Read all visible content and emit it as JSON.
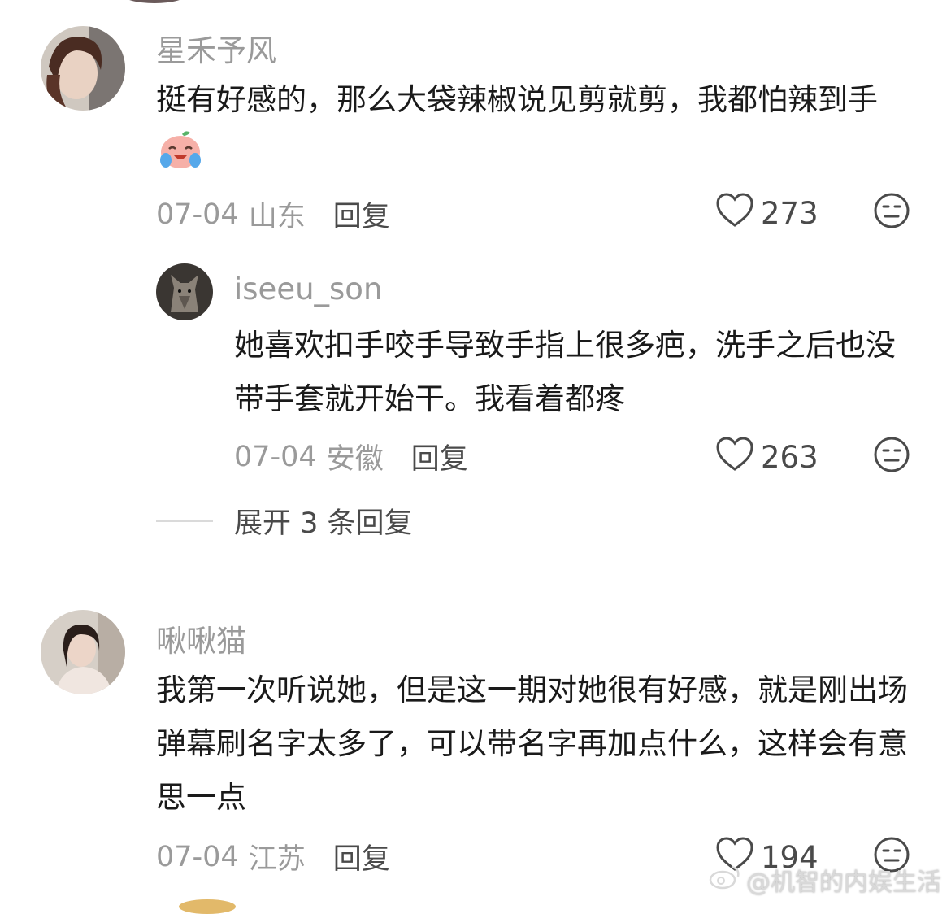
{
  "comments": [
    {
      "username": "星禾予风",
      "text": "挺有好感的，那么大袋辣椒说见剪就剪，我都怕辣到手",
      "date": "07-04",
      "location": "山东",
      "reply_label": "回复",
      "likes": "273",
      "avatar_icon": "avatar-photo"
    },
    {
      "username": "iseeu_son",
      "text": "她喜欢扣手咬手导致手指上很多疤，洗手之后也没带手套就开始干。我看着都疼",
      "date": "07-04",
      "location": "安徽",
      "reply_label": "回复",
      "likes": "263",
      "avatar_icon": "wolf-avatar"
    },
    {
      "username": "啾啾猫",
      "text": "我第一次听说她，但是这一期对她很有好感，就是刚出场弹幕刷名字太多了，可以带名字再加点什么，这样会有意思一点",
      "date": "07-04",
      "location": "江苏",
      "reply_label": "回复",
      "likes": "194",
      "avatar_icon": "avatar-photo"
    }
  ],
  "expand_replies": "展开 3 条回复",
  "watermark": "@机智的内娱生活",
  "icons": {
    "like": "heart-outline-icon",
    "dislike": "meh-face-icon",
    "emoji": "crying-laughing-emoji"
  },
  "colors": {
    "username": "#9a9a9a",
    "text": "#1a1a1a",
    "meta": "#9a9a9a",
    "action": "#4a4a4a"
  }
}
